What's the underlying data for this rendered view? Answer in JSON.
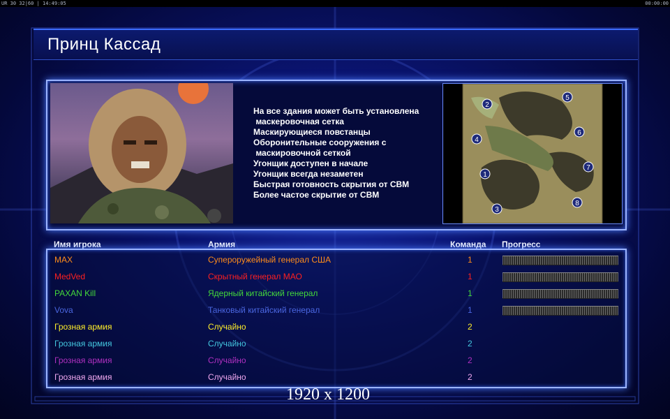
{
  "topbar": {
    "left": "UR 30 32|60 | 14:49:05",
    "right": "00:00:00"
  },
  "title": "Принц Кассад",
  "features_text": "На все здания может быть установлена\n маскеровочная сетка\nМаскирующиеся повстанцы\nОборонительные сооружения с\n маскировочной сеткой\nУгонщик доступен в начале\nУгонщик всегда незаметен\nБыстрая готовность скрытия от СВМ\nБолее частое скрытие от СВМ",
  "minimap": {
    "spawns": [
      "1",
      "2",
      "3",
      "4",
      "5",
      "6",
      "7",
      "8"
    ]
  },
  "headers": {
    "player": "Имя игрока",
    "army": "Армия",
    "team": "Команда",
    "progress": "Прогресс"
  },
  "players": [
    {
      "name": "MAX",
      "army": "Супероружейный генерал США",
      "team": "1",
      "color": "#ff8c1a",
      "progress": true
    },
    {
      "name": "MedVed",
      "army": "Скрытный генерал МАО",
      "team": "1",
      "color": "#ff2020",
      "progress": true
    },
    {
      "name": "PAXAN Kill",
      "army": "Ядерный китайский генерал",
      "team": "1",
      "color": "#44d83a",
      "progress": true
    },
    {
      "name": "Vova",
      "army": "Танковый китайский генерал",
      "team": "1",
      "color": "#4a66e0",
      "progress": true
    },
    {
      "name": "Грозная армия",
      "army": "Случайно",
      "team": "2",
      "color": "#ffee2a",
      "progress": false
    },
    {
      "name": "Грозная армия",
      "army": "Случайно",
      "team": "2",
      "color": "#44c8e0",
      "progress": false
    },
    {
      "name": "Грозная армия",
      "army": "Случайно",
      "team": "2",
      "color": "#b030c0",
      "progress": false
    },
    {
      "name": "Грозная армия",
      "army": "Случайно",
      "team": "2",
      "color": "#f0a8f0",
      "progress": false
    }
  ],
  "resolution": "1920 x 1200"
}
